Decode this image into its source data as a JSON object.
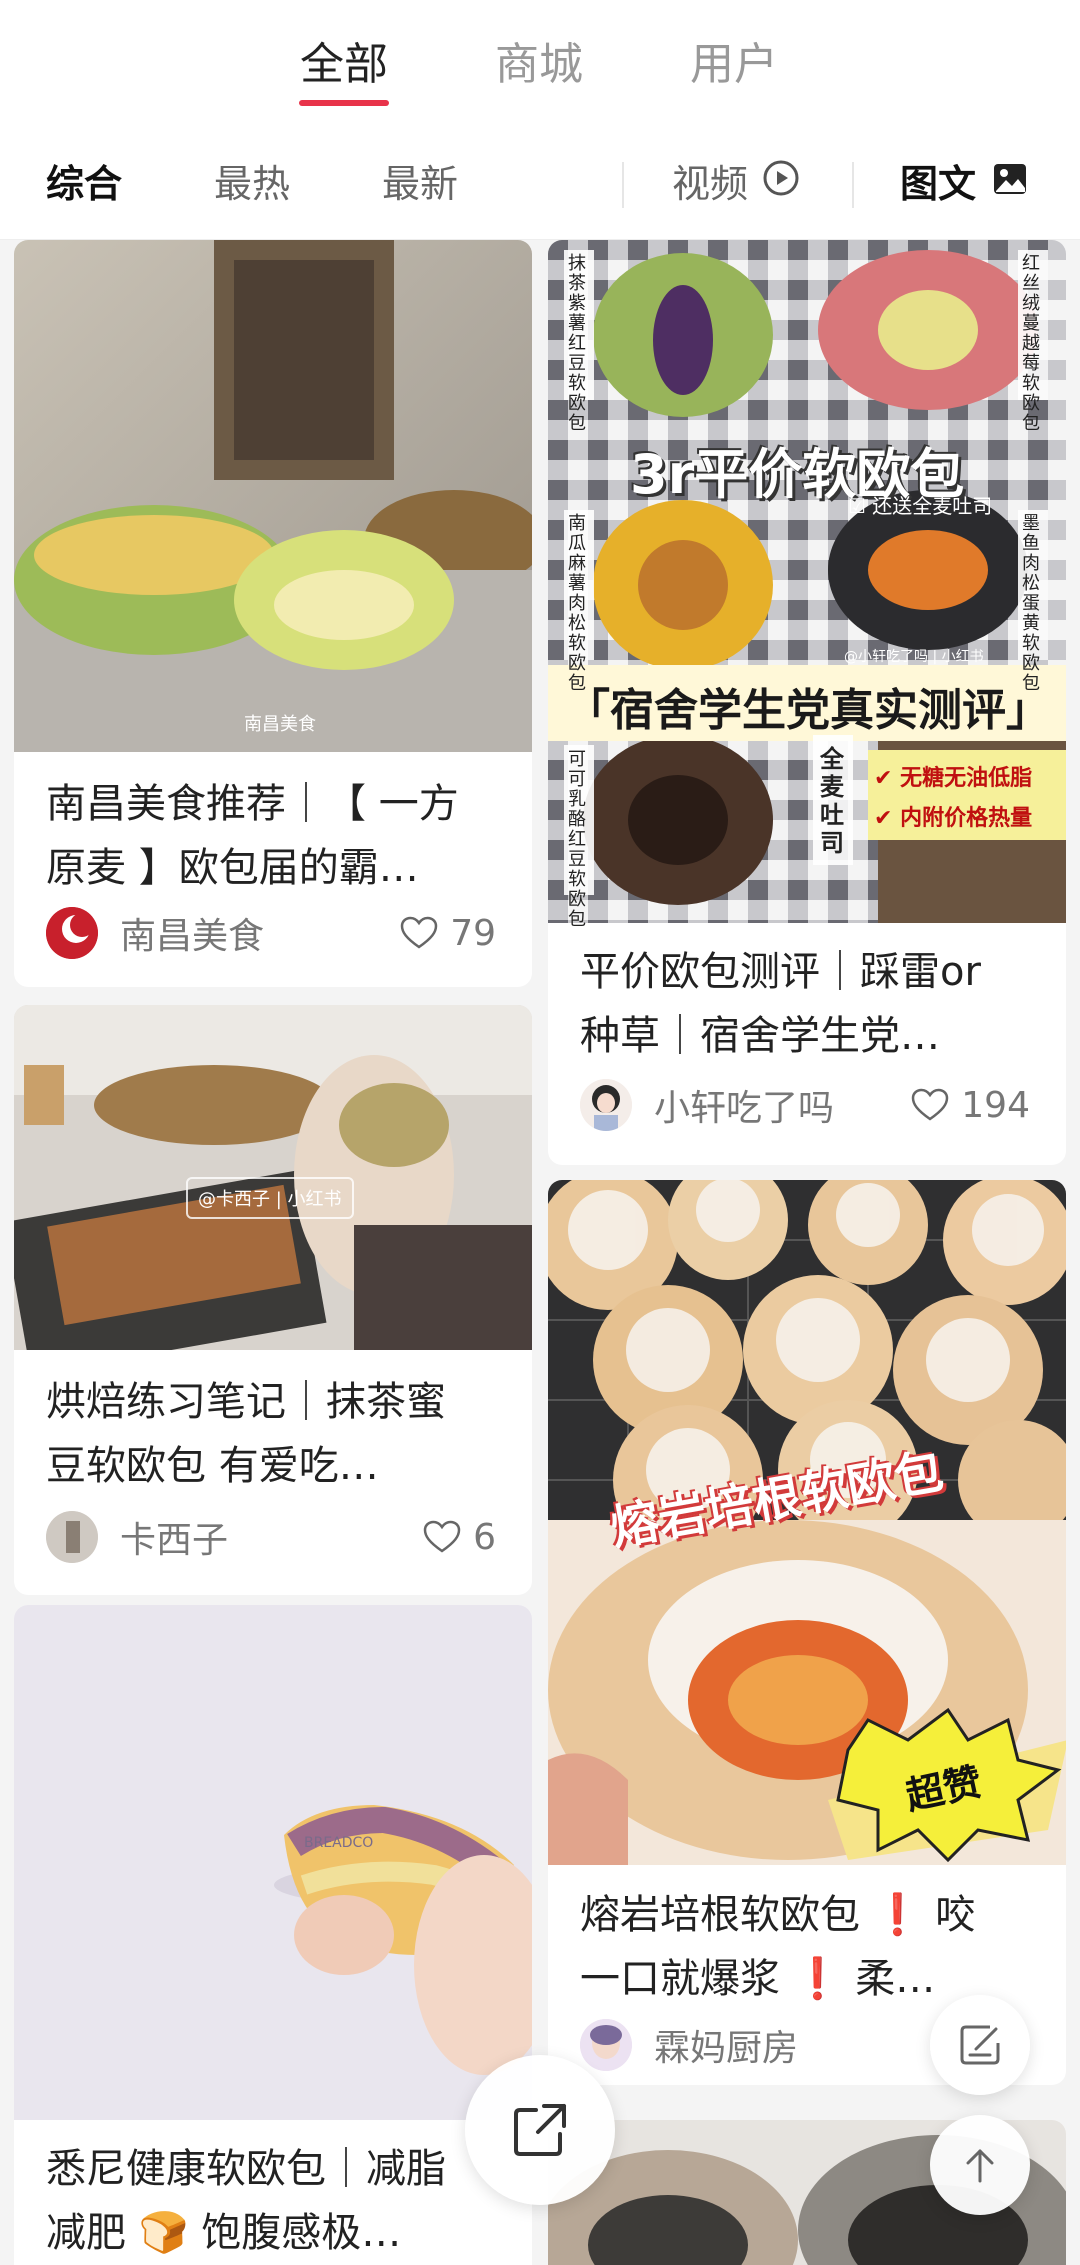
{
  "top_tabs": [
    {
      "label": "全部",
      "active": true
    },
    {
      "label": "商城",
      "active": false
    },
    {
      "label": "用户",
      "active": false
    }
  ],
  "filters": {
    "sort": [
      "综合",
      "最热",
      "最新"
    ],
    "video_label": "视频",
    "image_text_label": "图文"
  },
  "accent_color": "#e8334a",
  "cards": [
    {
      "title_line1": "南昌美食推荐｜【 一方",
      "title_line2": "原麦 】欧包届的霸…",
      "author": "南昌美食",
      "likes": "79",
      "image_caption": "南昌美食"
    },
    {
      "title_line1": "平价欧包测评｜踩雷or",
      "title_line2": "种草｜宿舍学生党…",
      "author": "小轩吃了吗",
      "likes": "194",
      "image_heading": "3r平价软欧包",
      "image_banner": "「宿舍学生党真实测评」",
      "image_note": "☑ 还送全麦吐司",
      "image_check1": "无糖无油低脂",
      "image_check2": "内附价格热量",
      "image_watermark": "@小轩吃了吗 | 小红书",
      "image_labels": [
        "抹茶紫薯红豆软欧包",
        "红丝绒蔓越莓软欧包",
        "南瓜麻薯肉松软欧包",
        "墨鱼肉松蛋黄软欧包",
        "可可乳酪红豆软欧包",
        "全麦吐司"
      ]
    },
    {
      "title_line1": "烘焙练习笔记｜抹茶蜜",
      "title_line2": "豆软欧包 有爱吃…",
      "author": "卡西子",
      "likes": "6",
      "image_watermark": "@卡西子 | 小红书"
    },
    {
      "title_line1": "熔岩培根软欧包 ❗ 咬",
      "title_line2": "一口就爆浆 ❗ 柔…",
      "author": "霖妈厨房",
      "likes": "",
      "image_heading": "熔岩培根软欧包",
      "image_badge": "超赞"
    },
    {
      "title_line1": "悉尼健康软欧包｜减脂",
      "title_line2": "减肥 🍞 饱腹感极…",
      "author": "",
      "likes": "",
      "image_watermark": "BREADCO"
    }
  ]
}
